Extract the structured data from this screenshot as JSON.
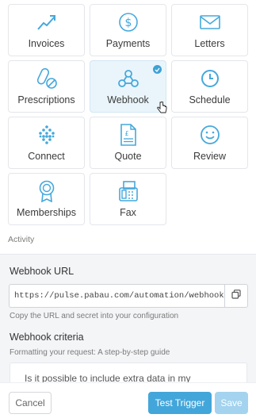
{
  "tiles": [
    {
      "label": "Invoices",
      "icon": "chart-trend-icon"
    },
    {
      "label": "Payments",
      "icon": "dollar-circle-icon"
    },
    {
      "label": "Letters",
      "icon": "envelope-icon"
    },
    {
      "label": "Prescriptions",
      "icon": "pills-icon"
    },
    {
      "label": "Webhook",
      "icon": "webhook-icon",
      "selected": true
    },
    {
      "label": "Schedule",
      "icon": "clock-icon"
    },
    {
      "label": "Connect",
      "icon": "diamond-dots-icon"
    },
    {
      "label": "Quote",
      "icon": "pound-document-icon"
    },
    {
      "label": "Review",
      "icon": "smiley-icon"
    },
    {
      "label": "Memberships",
      "icon": "badge-ribbon-icon"
    },
    {
      "label": "Fax",
      "icon": "fax-icon"
    }
  ],
  "activity_label": "Activity",
  "webhook": {
    "url_title": "Webhook URL",
    "url_value": "https://pulse.pabau.com/automation/webhook/?ke",
    "copy_hint": "Copy the URL and secret into your configuration",
    "criteria_title": "Webhook criteria",
    "criteria_hint": "Formatting your request: A step-by-step guide",
    "faq_question": "Is it possible to include extra data in my"
  },
  "footer": {
    "cancel": "Cancel",
    "test_trigger": "Test Trigger",
    "save": "Save"
  },
  "colors": {
    "accent": "#3ea2d6",
    "icon": "#45a8dc",
    "selected_bg": "#eaf5fb",
    "save_disabled": "#a3d3ee"
  }
}
